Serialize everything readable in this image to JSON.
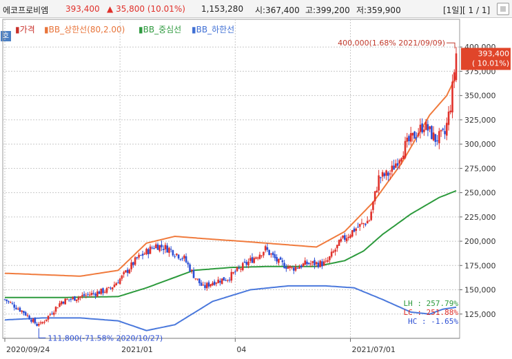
{
  "header": {
    "stock_name": "에코프로비엠",
    "price": "393,400",
    "change_arrow": "▲",
    "change": "35,800 (10.01%)",
    "volume": "1,153,280",
    "open": "시:367,400",
    "high": "고:399,200",
    "low": "저:359,900",
    "page": "[1일][ 1 / 1]"
  },
  "side_button": "호",
  "legend": {
    "price": "▮가격",
    "upper": "▮BB_상한선(80,2.00)",
    "mid": "▮BB_중심선",
    "lower": "▮BB_하한선"
  },
  "annotations": {
    "max_label": "400,000(1.68% 2021/09/09)",
    "min_label": "111,800(-71.58% 2020/10/27)",
    "price_tag_value": "393,400",
    "price_tag_pct": "( 10.01%)"
  },
  "stats": {
    "lh": "LH :  257.79%",
    "lc": "LC :  251.88%",
    "hc": "HC :   -1.65%"
  },
  "colors": {
    "up": "#e0302a",
    "down": "#2c4fd4",
    "upper_band": "#f07a3c",
    "mid_band": "#2c9a3c",
    "lower_band": "#4a78dc",
    "price_tag": "#e0452a"
  },
  "chart_data": {
    "type": "candlestick",
    "ylim": [
      100000,
      420000
    ],
    "yticks": [
      125000,
      150000,
      175000,
      200000,
      225000,
      250000,
      275000,
      300000,
      325000,
      350000,
      375000,
      400000
    ],
    "ytick_labels": [
      "125,000",
      "150,000",
      "175,000",
      "200,000",
      "225,000",
      "250,000",
      "275,000",
      "300,000",
      "325,000",
      "350,000",
      "375,000",
      "400,000"
    ],
    "x_count": 240,
    "xticks": [
      {
        "label": "2020/09/24",
        "index": 0
      },
      {
        "label": "2021/01",
        "index": 61
      },
      {
        "label": "04",
        "index": 122
      },
      {
        "label": "2021/07/01",
        "index": 183
      }
    ],
    "bands": {
      "upper": {
        "name": "BB_상한선(80,2.00)",
        "points": [
          [
            0,
            167000
          ],
          [
            40,
            164000
          ],
          [
            60,
            170000
          ],
          [
            75,
            198000
          ],
          [
            90,
            205000
          ],
          [
            110,
            202000
          ],
          [
            125,
            200000
          ],
          [
            145,
            197000
          ],
          [
            165,
            194000
          ],
          [
            180,
            210000
          ],
          [
            195,
            240000
          ],
          [
            210,
            280000
          ],
          [
            225,
            330000
          ],
          [
            234,
            350000
          ],
          [
            239,
            370000
          ]
        ]
      },
      "mid": {
        "name": "BB_중심선",
        "points": [
          [
            0,
            142000
          ],
          [
            30,
            142000
          ],
          [
            60,
            143000
          ],
          [
            75,
            152000
          ],
          [
            100,
            170000
          ],
          [
            120,
            173000
          ],
          [
            140,
            174000
          ],
          [
            165,
            174000
          ],
          [
            180,
            180000
          ],
          [
            190,
            190000
          ],
          [
            200,
            207000
          ],
          [
            215,
            228000
          ],
          [
            230,
            245000
          ],
          [
            239,
            252000
          ]
        ]
      },
      "lower": {
        "name": "BB_하한선",
        "points": [
          [
            0,
            119000
          ],
          [
            20,
            121000
          ],
          [
            40,
            121000
          ],
          [
            60,
            118000
          ],
          [
            75,
            108000
          ],
          [
            90,
            114000
          ],
          [
            110,
            138000
          ],
          [
            130,
            150000
          ],
          [
            150,
            154000
          ],
          [
            170,
            154000
          ],
          [
            185,
            152000
          ],
          [
            200,
            140000
          ],
          [
            215,
            127000
          ],
          [
            225,
            125000
          ],
          [
            232,
            130000
          ],
          [
            239,
            132000
          ]
        ]
      }
    },
    "price_path": [
      [
        0,
        140000
      ],
      [
        10,
        127000
      ],
      [
        18,
        112000
      ],
      [
        24,
        125000
      ],
      [
        30,
        138000
      ],
      [
        40,
        143000
      ],
      [
        55,
        150000
      ],
      [
        62,
        163000
      ],
      [
        70,
        182000
      ],
      [
        80,
        196000
      ],
      [
        87,
        192000
      ],
      [
        95,
        182000
      ],
      [
        100,
        165000
      ],
      [
        105,
        152000
      ],
      [
        110,
        158000
      ],
      [
        118,
        162000
      ],
      [
        128,
        177000
      ],
      [
        138,
        192000
      ],
      [
        145,
        178000
      ],
      [
        152,
        172000
      ],
      [
        160,
        177000
      ],
      [
        170,
        177000
      ],
      [
        178,
        200000
      ],
      [
        185,
        212000
      ],
      [
        193,
        222000
      ],
      [
        198,
        265000
      ],
      [
        204,
        270000
      ],
      [
        212,
        298000
      ],
      [
        222,
        320000
      ],
      [
        228,
        305000
      ],
      [
        233,
        310000
      ],
      [
        236,
        340000
      ],
      [
        239,
        393400
      ]
    ],
    "last_close": 393400,
    "max": {
      "index": 239,
      "value": 400000,
      "label": "400,000(1.68% 2021/09/09)"
    },
    "min": {
      "index": 18,
      "value": 111800,
      "label": "111,800(-71.58% 2020/10/27)"
    }
  }
}
